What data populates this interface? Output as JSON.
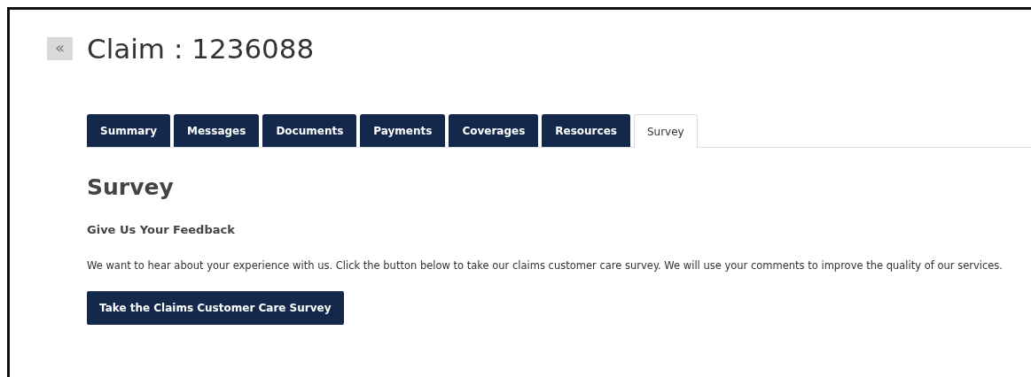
{
  "header": {
    "collapse_glyph": "«",
    "title": "Claim : 1236088"
  },
  "tabs": [
    {
      "label": "Summary",
      "selected": false
    },
    {
      "label": "Messages",
      "selected": false
    },
    {
      "label": "Documents",
      "selected": false
    },
    {
      "label": "Payments",
      "selected": false
    },
    {
      "label": "Coverages",
      "selected": false
    },
    {
      "label": "Resources",
      "selected": false
    },
    {
      "label": "Survey",
      "selected": true
    }
  ],
  "content": {
    "heading": "Survey",
    "subheading": "Give Us Your Feedback",
    "paragraph": "We want to hear about your experience with us. Click the button below to take our claims customer care survey. We will use your comments to improve the quality of our services.",
    "button": "Take the Claims Customer Care Survey"
  }
}
